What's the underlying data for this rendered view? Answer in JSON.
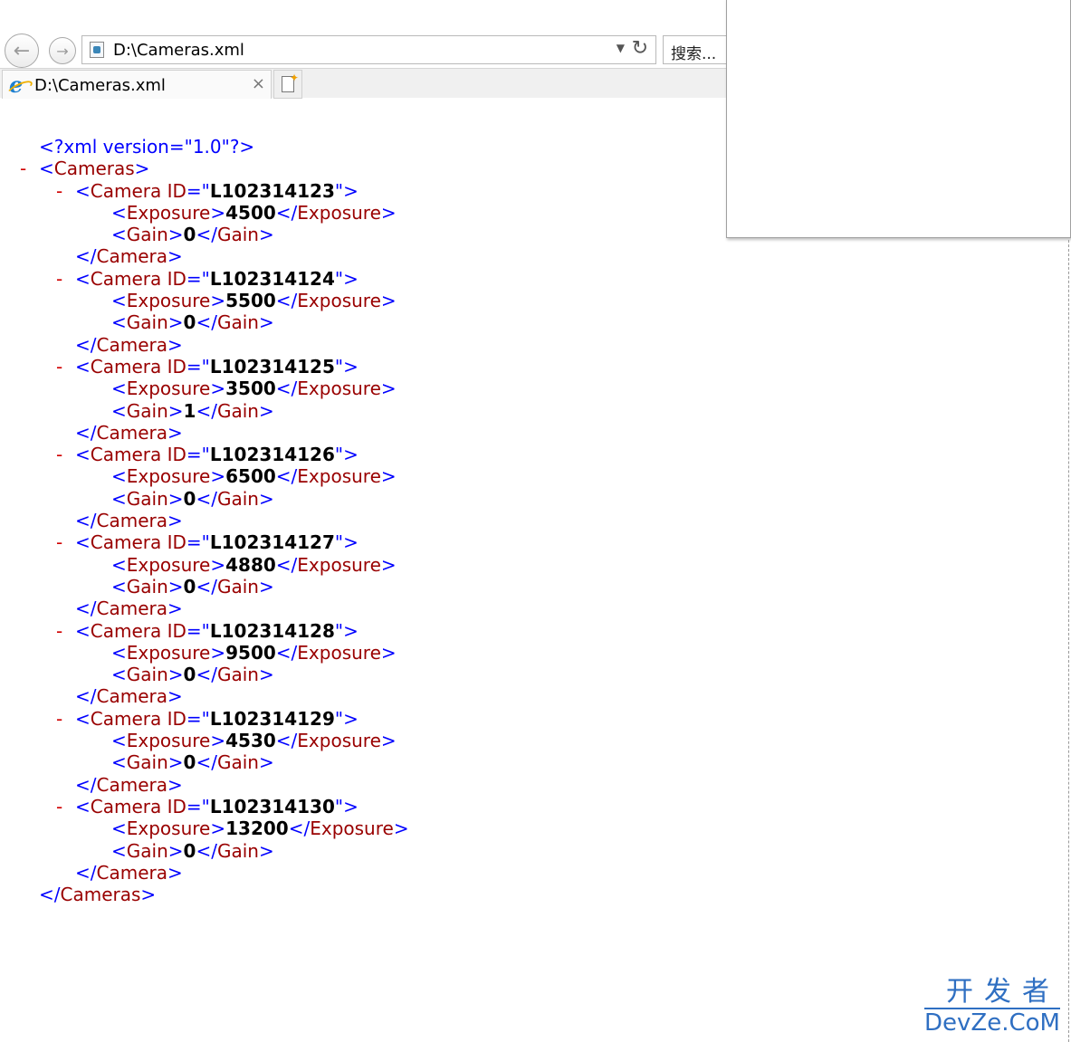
{
  "browser": {
    "address": "D:\\Cameras.xml",
    "search_placeholder": "搜索...",
    "tab_title": "D:\\Cameras.xml",
    "back_symbol": "←",
    "forward_symbol": "→",
    "refresh_symbol": "↻",
    "dropdown_symbol": "▼",
    "close_symbol": "×"
  },
  "xml": {
    "declaration": "<?xml version=\"1.0\"?>",
    "collapse_symbol": "-",
    "root": "Cameras",
    "attribute": "ID",
    "cameras": [
      {
        "id": "L102314123",
        "exposure": "4500",
        "gain": "0"
      },
      {
        "id": "L102314124",
        "exposure": "5500",
        "gain": "0"
      },
      {
        "id": "L102314125",
        "exposure": "3500",
        "gain": "1"
      },
      {
        "id": "L102314126",
        "exposure": "6500",
        "gain": "0"
      },
      {
        "id": "L102314127",
        "exposure": "4880",
        "gain": "0"
      },
      {
        "id": "L102314128",
        "exposure": "9500",
        "gain": "0"
      },
      {
        "id": "L102314129",
        "exposure": "4530",
        "gain": "0"
      },
      {
        "id": "L102314130",
        "exposure": "13200",
        "gain": "0"
      }
    ]
  },
  "watermark": {
    "line1": "开发者",
    "line2": "DevZe.CoM"
  },
  "colors": {
    "markup": "#0000ff",
    "tag_name": "#990000",
    "collapse": "#d00000",
    "watermark": "#2f6fc2"
  }
}
